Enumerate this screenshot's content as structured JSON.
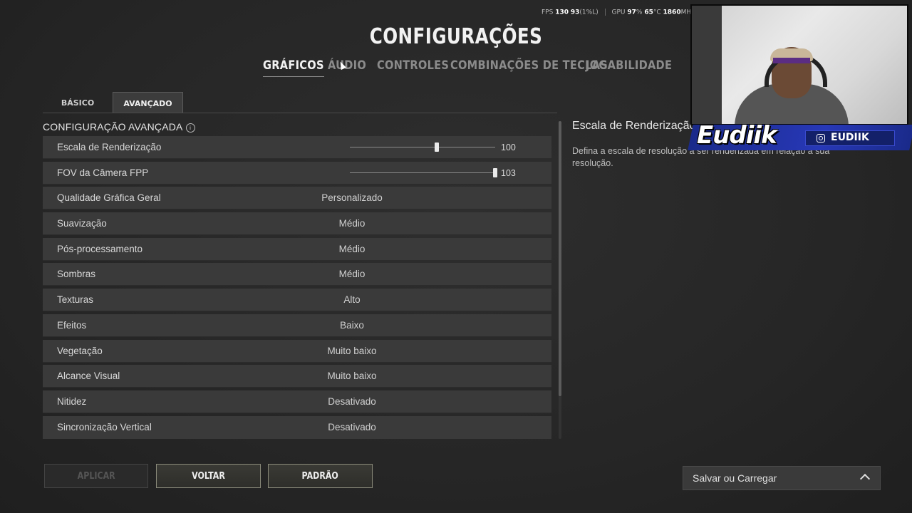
{
  "perf": {
    "fps_label": "FPS",
    "fps_value": "130",
    "fps_low": "93",
    "fps_low_label": "(1%L)",
    "gpu_label": "GPU",
    "gpu_usage": "97",
    "gpu_usage_unit": "%",
    "gpu_temp": "65",
    "gpu_temp_unit": "°C",
    "gpu_clock": "1860",
    "gpu_clock_unit": "MHz"
  },
  "title": "CONFIGURAÇÕES",
  "main_tabs": [
    {
      "label": "GRÁFICOS",
      "active": true
    },
    {
      "label": "ÁUDIO",
      "active": false
    },
    {
      "label": "CONTROLES",
      "active": false
    },
    {
      "label": "COMBINAÇÕES DE TECLAS",
      "active": false
    },
    {
      "label": "JOGABILIDADE",
      "active": false
    }
  ],
  "sub_tabs": [
    {
      "label": "BÁSICO",
      "active": false
    },
    {
      "label": "AVANÇADO",
      "active": true
    }
  ],
  "section_title": "CONFIGURAÇÃO AVANÇADA",
  "info_icon": "i",
  "settings": [
    {
      "label": "Escala de Renderização",
      "type": "slider",
      "value": "100",
      "level": 0.6
    },
    {
      "label": "FOV da Câmera FPP",
      "type": "slider",
      "value": "103",
      "level": 1.0
    },
    {
      "label": "Qualidade Gráfica Geral",
      "type": "select",
      "value": "Personalizado"
    },
    {
      "label": "Suavização",
      "type": "select",
      "value": "Médio"
    },
    {
      "label": "Pós-processamento",
      "type": "select",
      "value": "Médio"
    },
    {
      "label": "Sombras",
      "type": "select",
      "value": "Médio"
    },
    {
      "label": "Texturas",
      "type": "select",
      "value": "Alto"
    },
    {
      "label": "Efeitos",
      "type": "select",
      "value": "Baixo"
    },
    {
      "label": "Vegetação",
      "type": "select",
      "value": "Muito baixo"
    },
    {
      "label": "Alcance Visual",
      "type": "select",
      "value": "Muito baixo"
    },
    {
      "label": "Nitidez",
      "type": "select",
      "value": "Desativado"
    },
    {
      "label": "Sincronização Vertical",
      "type": "select",
      "value": "Desativado"
    }
  ],
  "description": {
    "title": "Escala de Renderização",
    "text": "Defina a escala de resolução a ser renderizada em relação à sua resolução."
  },
  "buttons": {
    "apply": "APLICAR",
    "back": "VOLTAR",
    "default": "PADRÃO"
  },
  "save_load": "Salvar ou Carregar",
  "overlay": {
    "brand_name": "Eudiik",
    "handle": "EUDIIK",
    "brand_color": "#2738b8"
  }
}
